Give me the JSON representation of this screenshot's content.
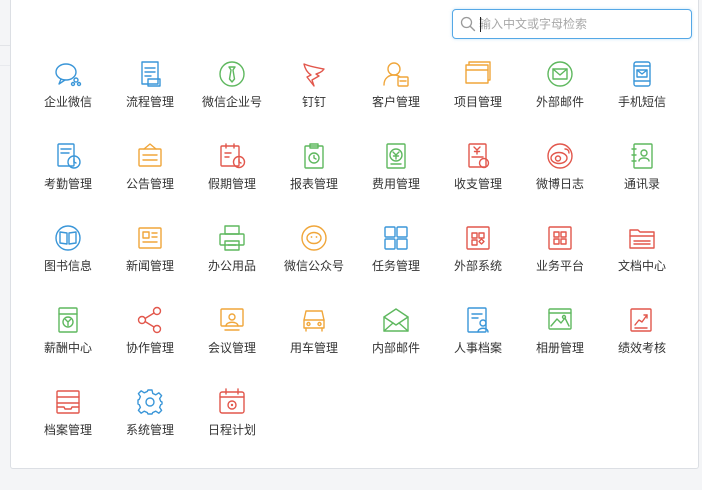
{
  "search": {
    "placeholder": "输入中文或字母检索",
    "value": ""
  },
  "apps": [
    {
      "label": "企业微信",
      "icon": "enterprise-wechat-icon",
      "color": "#3a96d8"
    },
    {
      "label": "流程管理",
      "icon": "process-document-icon",
      "color": "#3a96d8"
    },
    {
      "label": "微信企业号",
      "icon": "wechat-enterprise-tie-icon",
      "color": "#5fb85f"
    },
    {
      "label": "钉钉",
      "icon": "dingtalk-icon",
      "color": "#e2574c"
    },
    {
      "label": "客户管理",
      "icon": "customer-user-icon",
      "color": "#f0a63a"
    },
    {
      "label": "项目管理",
      "icon": "project-folders-icon",
      "color": "#f0a63a"
    },
    {
      "label": "外部邮件",
      "icon": "external-mail-icon",
      "color": "#5fb85f"
    },
    {
      "label": "手机短信",
      "icon": "mobile-sms-icon",
      "color": "#3a96d8"
    },
    {
      "label": "考勤管理",
      "icon": "attendance-clock-icon",
      "color": "#3a96d8"
    },
    {
      "label": "公告管理",
      "icon": "notice-board-icon",
      "color": "#f0a63a"
    },
    {
      "label": "假期管理",
      "icon": "holiday-calendar-icon",
      "color": "#e2574c"
    },
    {
      "label": "报表管理",
      "icon": "report-clock-icon",
      "color": "#5fb85f"
    },
    {
      "label": "费用管理",
      "icon": "expense-yuan-icon",
      "color": "#5fb85f"
    },
    {
      "label": "收支管理",
      "icon": "income-expense-icon",
      "color": "#e2574c"
    },
    {
      "label": "微博日志",
      "icon": "weibo-icon",
      "color": "#e2574c"
    },
    {
      "label": "通讯录",
      "icon": "contacts-book-icon",
      "color": "#5fb85f"
    },
    {
      "label": "图书信息",
      "icon": "book-info-icon",
      "color": "#3a96d8"
    },
    {
      "label": "新闻管理",
      "icon": "news-icon",
      "color": "#f0a63a"
    },
    {
      "label": "办公用品",
      "icon": "office-printer-icon",
      "color": "#5fb85f"
    },
    {
      "label": "微信公众号",
      "icon": "wechat-official-icon",
      "color": "#f0a63a"
    },
    {
      "label": "任务管理",
      "icon": "task-grid-icon",
      "color": "#3a96d8"
    },
    {
      "label": "外部系统",
      "icon": "external-system-icon",
      "color": "#e2574c"
    },
    {
      "label": "业务平台",
      "icon": "business-platform-icon",
      "color": "#e2574c"
    },
    {
      "label": "文档中心",
      "icon": "document-center-icon",
      "color": "#e2574c"
    },
    {
      "label": "薪酬中心",
      "icon": "salary-icon",
      "color": "#5fb85f"
    },
    {
      "label": "协作管理",
      "icon": "share-collaboration-icon",
      "color": "#e2574c"
    },
    {
      "label": "会议管理",
      "icon": "meeting-icon",
      "color": "#f0a63a"
    },
    {
      "label": "用车管理",
      "icon": "car-icon",
      "color": "#f0a63a"
    },
    {
      "label": "内部邮件",
      "icon": "internal-mail-icon",
      "color": "#5fb85f"
    },
    {
      "label": "人事档案",
      "icon": "hr-file-icon",
      "color": "#3a96d8"
    },
    {
      "label": "相册管理",
      "icon": "photo-album-icon",
      "color": "#5fb85f"
    },
    {
      "label": "绩效考核",
      "icon": "performance-chart-icon",
      "color": "#e2574c"
    },
    {
      "label": "档案管理",
      "icon": "archive-tray-icon",
      "color": "#e2574c"
    },
    {
      "label": "系统管理",
      "icon": "settings-gear-icon",
      "color": "#3a96d8"
    },
    {
      "label": "日程计划",
      "icon": "schedule-calendar-icon",
      "color": "#e2574c"
    }
  ]
}
